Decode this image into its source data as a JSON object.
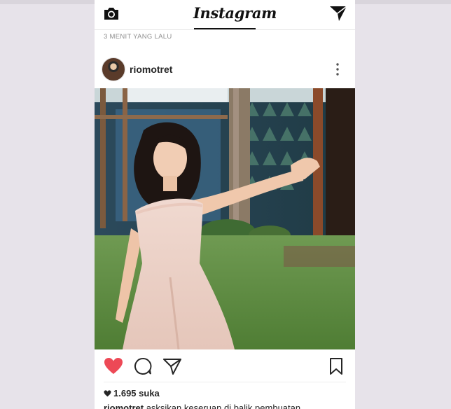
{
  "header": {
    "logo_text": "Instagram"
  },
  "post": {
    "time_ago": "3 MENIT YANG LALU",
    "username": "riomotret",
    "likes": "1.695 suka",
    "caption_user": "riomotret",
    "caption_text": "asksikan keseruan di balik pembuatan"
  },
  "icons": {
    "camera": "camera-icon",
    "direct": "direct-message-icon",
    "more": "more-options-icon",
    "like": "heart-icon",
    "comment": "comment-icon",
    "share": "share-icon",
    "save": "bookmark-icon"
  },
  "colors": {
    "like_red": "#ed4956",
    "text": "#262626",
    "muted": "#8e8e8e"
  }
}
